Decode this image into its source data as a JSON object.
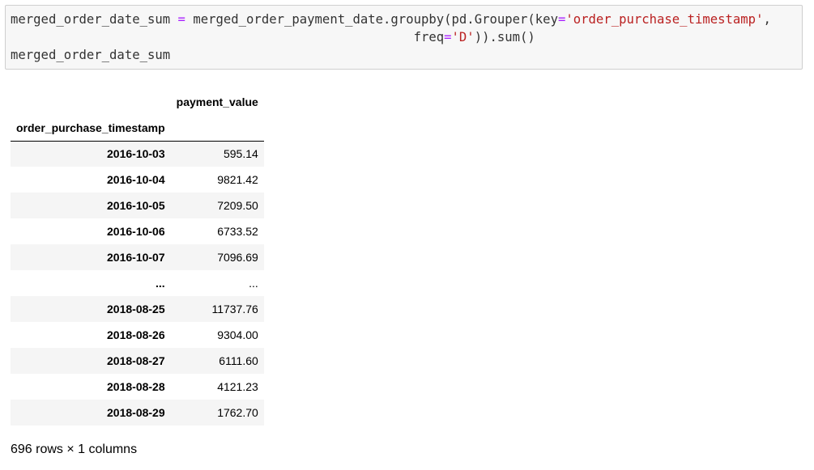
{
  "code": {
    "line1_a": "merged_order_date_sum ",
    "line1_eq": "=",
    "line1_b": " merged_order_payment_date.groupby(pd.Grouper(key",
    "line1_eq2": "=",
    "line1_str": "'order_purchase_timestamp'",
    "line1_c": ",",
    "line2_a": "                                                     freq",
    "line2_eq": "=",
    "line2_str": "'D'",
    "line2_b": ")).sum()",
    "line3": "merged_order_date_sum"
  },
  "table": {
    "column_header": "payment_value",
    "index_name": "order_purchase_timestamp",
    "rows": [
      {
        "index": "2016-10-03",
        "value": "595.14"
      },
      {
        "index": "2016-10-04",
        "value": "9821.42"
      },
      {
        "index": "2016-10-05",
        "value": "7209.50"
      },
      {
        "index": "2016-10-06",
        "value": "6733.52"
      },
      {
        "index": "2016-10-07",
        "value": "7096.69"
      },
      {
        "index": "...",
        "value": "..."
      },
      {
        "index": "2018-08-25",
        "value": "11737.76"
      },
      {
        "index": "2018-08-26",
        "value": "9304.00"
      },
      {
        "index": "2018-08-27",
        "value": "6111.60"
      },
      {
        "index": "2018-08-28",
        "value": "4121.23"
      },
      {
        "index": "2018-08-29",
        "value": "1762.70"
      }
    ]
  },
  "footer": "696 rows × 1 columns"
}
